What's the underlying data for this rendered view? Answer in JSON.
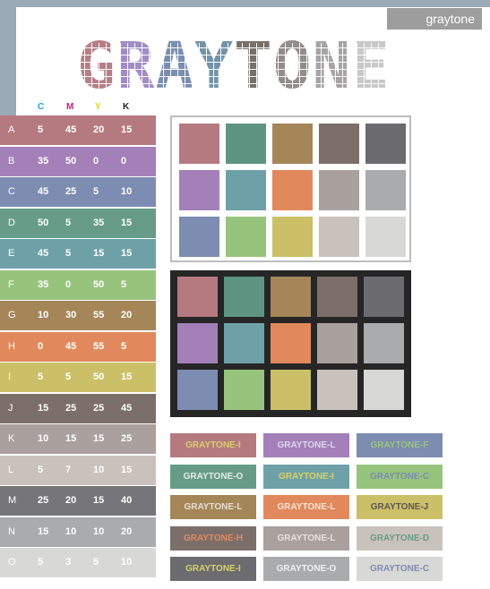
{
  "header": {
    "badge": "graytone"
  },
  "title": {
    "letters": [
      {
        "char": "G",
        "color": "#b57f85"
      },
      {
        "char": "R",
        "color": "#a18dc6"
      },
      {
        "char": "A",
        "color": "#7a8eb0"
      },
      {
        "char": "Y",
        "color": "#7294a8"
      },
      {
        "char": "T",
        "color": "#787068"
      },
      {
        "char": "O",
        "color": "#928c8a"
      },
      {
        "char": "N",
        "color": "#a6a4a4"
      },
      {
        "char": "E",
        "color": "#c9c8c8"
      }
    ]
  },
  "cmyk_headers": [
    {
      "label": "C",
      "color": "#1aa5d9"
    },
    {
      "label": "M",
      "color": "#d0187a"
    },
    {
      "label": "Y",
      "color": "#e5d400"
    },
    {
      "label": "K",
      "color": "#222222"
    }
  ],
  "rows": [
    {
      "label": "A",
      "c": "5",
      "m": "45",
      "y": "20",
      "k": "15",
      "color": "#b57a80"
    },
    {
      "label": "B",
      "c": "35",
      "m": "50",
      "y": "0",
      "k": "0",
      "color": "#a380b8"
    },
    {
      "label": "C",
      "c": "45",
      "m": "25",
      "y": "5",
      "k": "10",
      "color": "#7d8cb1"
    },
    {
      "label": "D",
      "c": "50",
      "m": "5",
      "y": "35",
      "k": "15",
      "color": "#669c87"
    },
    {
      "label": "E",
      "c": "45",
      "m": "5",
      "y": "15",
      "k": "15",
      "color": "#6ea1a7"
    },
    {
      "label": "F",
      "c": "35",
      "m": "0",
      "y": "50",
      "k": "5",
      "color": "#97c47c"
    },
    {
      "label": "G",
      "c": "10",
      "m": "30",
      "y": "55",
      "k": "20",
      "color": "#a48659"
    },
    {
      "label": "H",
      "c": "0",
      "m": "45",
      "y": "55",
      "k": "5",
      "color": "#e1895c"
    },
    {
      "label": "I",
      "c": "5",
      "m": "5",
      "y": "50",
      "k": "15",
      "color": "#cbc068"
    },
    {
      "label": "J",
      "c": "15",
      "m": "25",
      "y": "25",
      "k": "45",
      "color": "#7c6f6a"
    },
    {
      "label": "K",
      "c": "10",
      "m": "15",
      "y": "15",
      "k": "25",
      "color": "#aaa09d"
    },
    {
      "label": "L",
      "c": "5",
      "m": "7",
      "y": "10",
      "k": "15",
      "color": "#c9c2bc"
    },
    {
      "label": "M",
      "c": "25",
      "m": "20",
      "y": "15",
      "k": "40",
      "color": "#767579"
    },
    {
      "label": "N",
      "c": "15",
      "m": "10",
      "y": "10",
      "k": "20",
      "color": "#a9abac"
    },
    {
      "label": "O",
      "c": "5",
      "m": "3",
      "y": "5",
      "k": "10",
      "color": "#d8d8d6"
    }
  ],
  "swatches": [
    [
      "#b57a80",
      "#5e9582",
      "#a48659",
      "#7c6f6a",
      "#6c6c70"
    ],
    [
      "#a380b8",
      "#6ea1a7",
      "#e1895c",
      "#aaa09d",
      "#a9abac"
    ],
    [
      "#7d8cb1",
      "#97c47c",
      "#cbc068",
      "#c9c2bc",
      "#d8d8d6"
    ]
  ],
  "buttons": [
    [
      {
        "label": "GRAYTONE-I",
        "bg": "#b57a80",
        "fg": "#d8d06a"
      },
      {
        "label": "GRAYTONE-L",
        "bg": "#a380b8",
        "fg": "#ddd6ee"
      },
      {
        "label": "GRAYTONE-F",
        "bg": "#7d8cb1",
        "fg": "#97c47c"
      }
    ],
    [
      {
        "label": "GRAYTONE-O",
        "bg": "#669c87",
        "fg": "#e6ebe6"
      },
      {
        "label": "GRAYTONE-I",
        "bg": "#6ea1a7",
        "fg": "#d8d06a"
      },
      {
        "label": "GRAYTONE-C",
        "bg": "#97c47c",
        "fg": "#7d8cb1"
      }
    ],
    [
      {
        "label": "GRAYTONE-L",
        "bg": "#a48659",
        "fg": "#e6ddd2"
      },
      {
        "label": "GRAYTONE-L",
        "bg": "#e1895c",
        "fg": "#f3e3d6"
      },
      {
        "label": "GRAYTONE-J",
        "bg": "#cbc068",
        "fg": "#5e5752"
      }
    ],
    [
      {
        "label": "GRAYTONE-H",
        "bg": "#7c6f6a",
        "fg": "#e1895c"
      },
      {
        "label": "GRAYTONE-L",
        "bg": "#aaa09d",
        "fg": "#e6e0dc"
      },
      {
        "label": "GRAYTONE-D",
        "bg": "#c9c2bc",
        "fg": "#669c87"
      }
    ],
    [
      {
        "label": "GRAYTONE-I",
        "bg": "#6c6c70",
        "fg": "#d8d06a"
      },
      {
        "label": "GRAYTONE-O",
        "bg": "#a9abac",
        "fg": "#f0f0f0"
      },
      {
        "label": "GRAYTONE-C",
        "bg": "#d8d8d6",
        "fg": "#7d8cb1"
      }
    ]
  ]
}
